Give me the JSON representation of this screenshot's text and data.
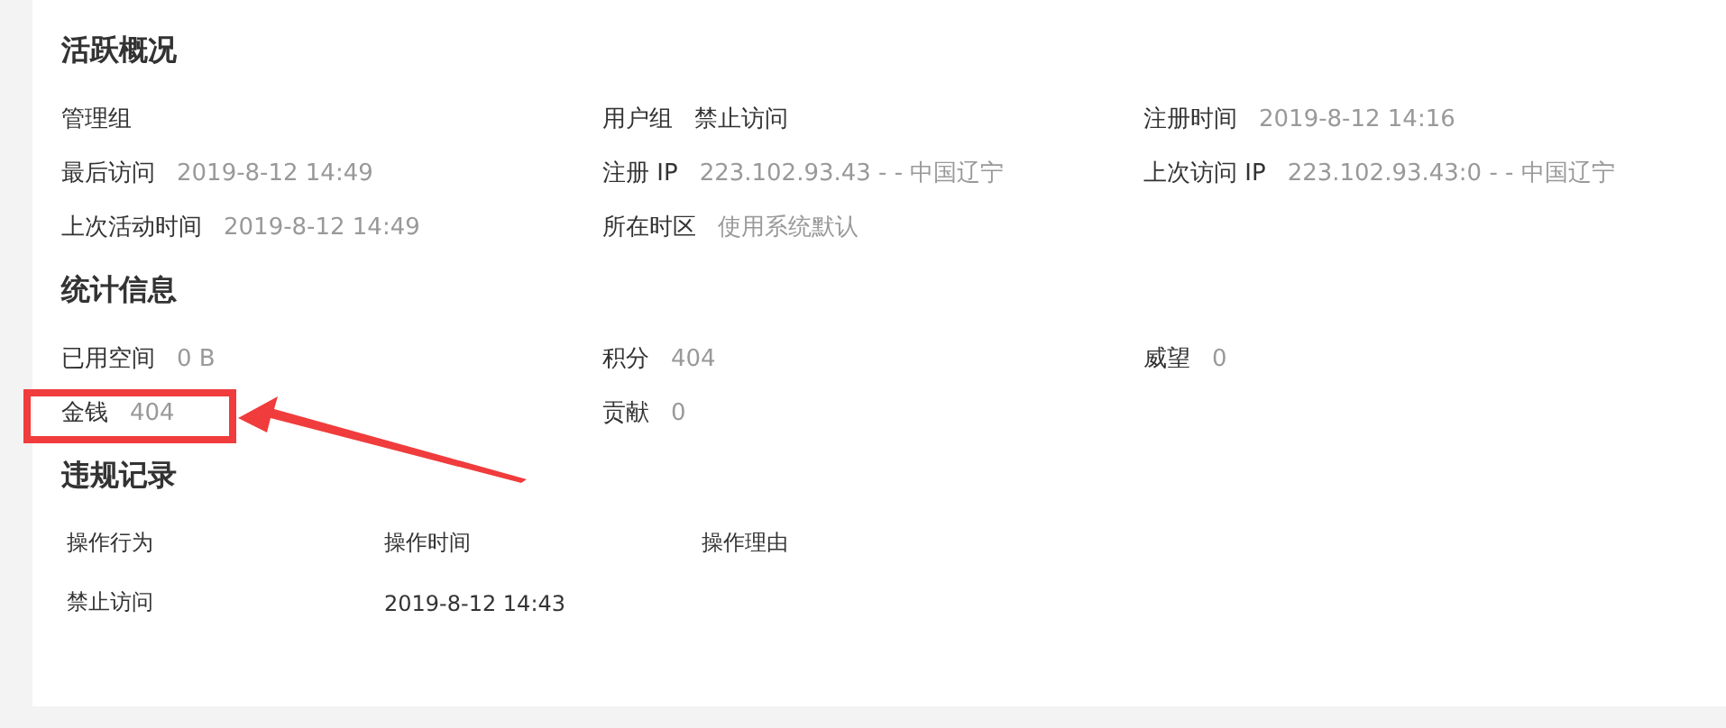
{
  "sections": [
    {
      "kind": "fields",
      "title": "活跃概况",
      "items": [
        {
          "label": "管理组",
          "highlighted": false
        },
        {
          "kind": "dark",
          "label": "用户组",
          "value": "禁止访问",
          "highlighted": false
        },
        {
          "kind": "muted",
          "label": "注册时间",
          "value": "2019-8-12 14:16",
          "highlighted": false
        },
        {
          "kind": "muted",
          "label": "最后访问",
          "value": "2019-8-12 14:49",
          "highlighted": false
        },
        {
          "kind": "muted",
          "label": "注册 IP",
          "value": "223.102.93.43 - - 中国辽宁",
          "highlighted": false
        },
        {
          "kind": "muted",
          "label": "上次访问 IP",
          "value": "223.102.93.43:0 - - 中国辽宁",
          "highlighted": false
        },
        {
          "kind": "muted",
          "label": "上次活动时间",
          "value": "2019-8-12 14:49",
          "highlighted": false
        },
        {
          "kind": "muted",
          "label": "所在时区",
          "value": "使用系统默认",
          "highlighted": false
        }
      ]
    },
    {
      "kind": "fields",
      "title": "统计信息",
      "items": [
        {
          "kind": "muted",
          "label": "已用空间",
          "value": "0 B",
          "highlighted": false
        },
        {
          "kind": "muted",
          "label": "积分",
          "value": "404",
          "highlighted": false
        },
        {
          "kind": "muted",
          "label": "威望",
          "value": "0",
          "highlighted": false
        },
        {
          "kind": "muted",
          "label": "金钱",
          "value": "404",
          "highlighted": true
        },
        {
          "kind": "muted",
          "label": "贡献",
          "value": "0",
          "highlighted": false
        }
      ]
    },
    {
      "kind": "table",
      "title": "违规记录",
      "columns": [
        "操作行为",
        "操作时间",
        "操作理由"
      ],
      "rows": [
        [
          "禁止访问",
          "2019-8-12 14:43",
          ""
        ]
      ]
    }
  ]
}
